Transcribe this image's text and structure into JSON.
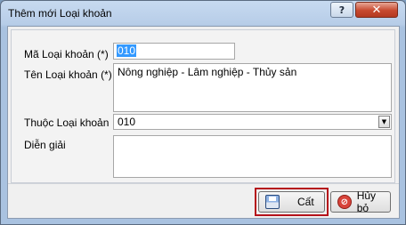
{
  "window": {
    "title": "Thêm mới Loại khoản",
    "help_glyph": "?",
    "close_glyph": "✕"
  },
  "form": {
    "code_label": "Mã Loại khoản (*)",
    "code_value": "010",
    "name_label": "Tên Loại khoản (*)",
    "name_value": "Nông nghiệp - Lâm nghiệp - Thủy sản",
    "parent_label": "Thuộc Loại khoản",
    "parent_value": "010",
    "parent_arrow": "▼",
    "desc_label": "Diễn giải",
    "desc_value": ""
  },
  "buttons": {
    "save_label": "Cất",
    "cancel_label": "Hủy bỏ",
    "cancel_glyph": "⊘"
  },
  "colors": {
    "highlight": "#b5121b",
    "selection": "#3399ff"
  }
}
